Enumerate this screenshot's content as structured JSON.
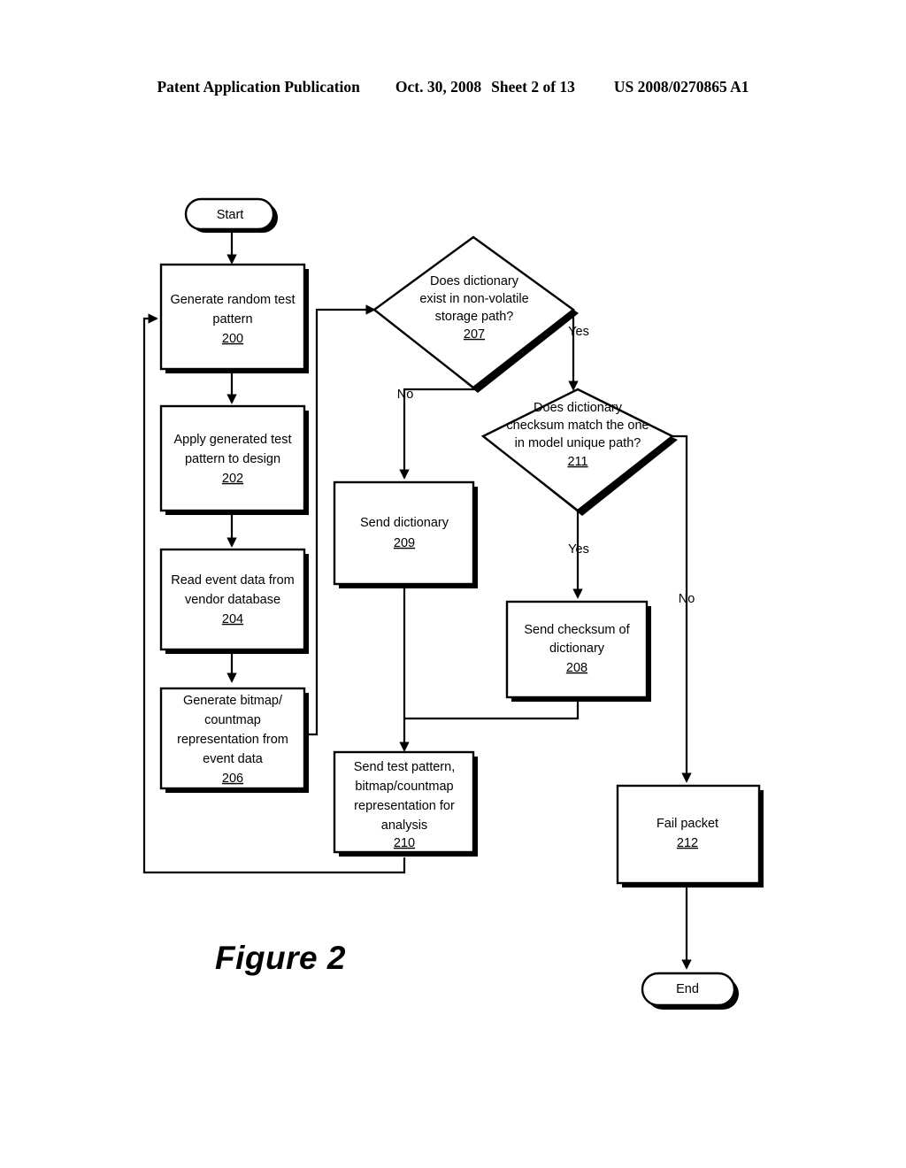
{
  "header": {
    "publication": "Patent Application Publication",
    "date": "Oct. 30, 2008",
    "sheet": "Sheet 2 of 13",
    "docnum": "US 2008/0270865 A1"
  },
  "figure": {
    "caption": "Figure 2"
  },
  "flowchart": {
    "nodes": {
      "start": {
        "label": "Start",
        "type": "terminator"
      },
      "end": {
        "label": "End",
        "type": "terminator"
      },
      "n200": {
        "lines": [
          "Generate random test",
          "pattern"
        ],
        "number": "200",
        "type": "process"
      },
      "n202": {
        "lines": [
          "Apply generated test",
          "pattern to design"
        ],
        "number": "202",
        "type": "process"
      },
      "n204": {
        "lines": [
          "Read event data from",
          "vendor database"
        ],
        "number": "204",
        "type": "process"
      },
      "n206": {
        "lines": [
          "Generate bitmap/",
          "countmap",
          "representation from",
          "event data"
        ],
        "number": "206",
        "type": "process"
      },
      "n207": {
        "lines": [
          "Does dictionary",
          "exist in non-volatile",
          "storage path?"
        ],
        "number": "207",
        "type": "decision"
      },
      "n211": {
        "lines": [
          "Does dictionary",
          "checksum match the one",
          "in model unique path?"
        ],
        "number": "211",
        "type": "decision"
      },
      "n209": {
        "lines": [
          "Send dictionary"
        ],
        "number": "209",
        "type": "process"
      },
      "n208": {
        "lines": [
          "Send checksum of",
          "dictionary"
        ],
        "number": "208",
        "type": "process"
      },
      "n210": {
        "lines": [
          "Send test pattern,",
          "bitmap/countmap",
          "representation for",
          "analysis"
        ],
        "number": "210",
        "type": "process"
      },
      "n212": {
        "lines": [
          "Fail packet"
        ],
        "number": "212",
        "type": "process"
      }
    },
    "edge_labels": {
      "d207_yes": "Yes",
      "d207_no": "No",
      "d211_yes": "Yes",
      "d211_no": "No"
    }
  },
  "colors": {
    "ink": "#000000",
    "paper": "#ffffff"
  }
}
